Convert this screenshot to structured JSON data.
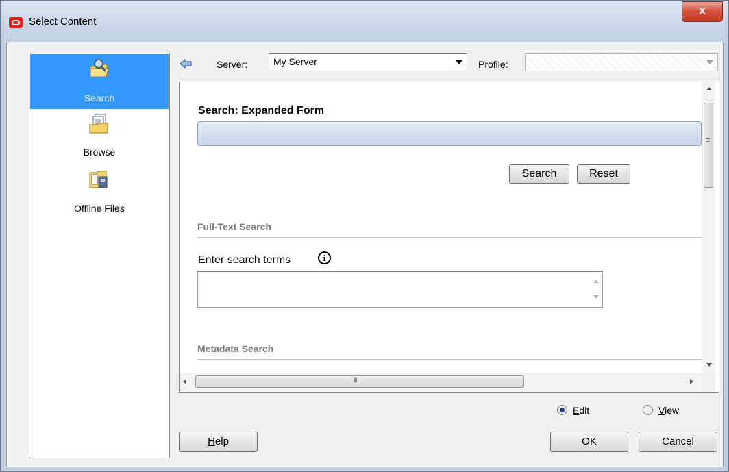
{
  "window": {
    "title": "Select Content",
    "close_glyph": "X"
  },
  "nav": {
    "items": [
      {
        "label": "Search",
        "icon": "search-folder-icon",
        "selected": true
      },
      {
        "label": "Browse",
        "icon": "browse-documents-icon",
        "selected": false
      },
      {
        "label": "Offline Files",
        "icon": "offline-files-icon",
        "selected": false
      }
    ]
  },
  "toolbar": {
    "server_label_prefix": "",
    "server_label_accel": "S",
    "server_label_rest": "erver:",
    "server_value": "My Server",
    "profile_label_accel": "P",
    "profile_label_rest": "rofile:",
    "profile_value": ""
  },
  "form": {
    "title": "Search: Expanded Form",
    "search_button": "Search",
    "reset_button": "Reset",
    "fulltext_heading": "Full-Text Search",
    "terms_label": "Enter search terms",
    "info_glyph": "i",
    "terms_value": "",
    "metadata_heading": "Metadata Search"
  },
  "mode": {
    "edit_accel": "E",
    "edit_rest": "dit",
    "view_accel": "V",
    "view_rest": "iew",
    "selected": "Edit"
  },
  "footer": {
    "help_accel": "H",
    "help_rest": "elp",
    "ok_label": "OK",
    "cancel_label": "Cancel"
  },
  "colors": {
    "selection": "#3399ff",
    "close_button": "#c23a22"
  }
}
